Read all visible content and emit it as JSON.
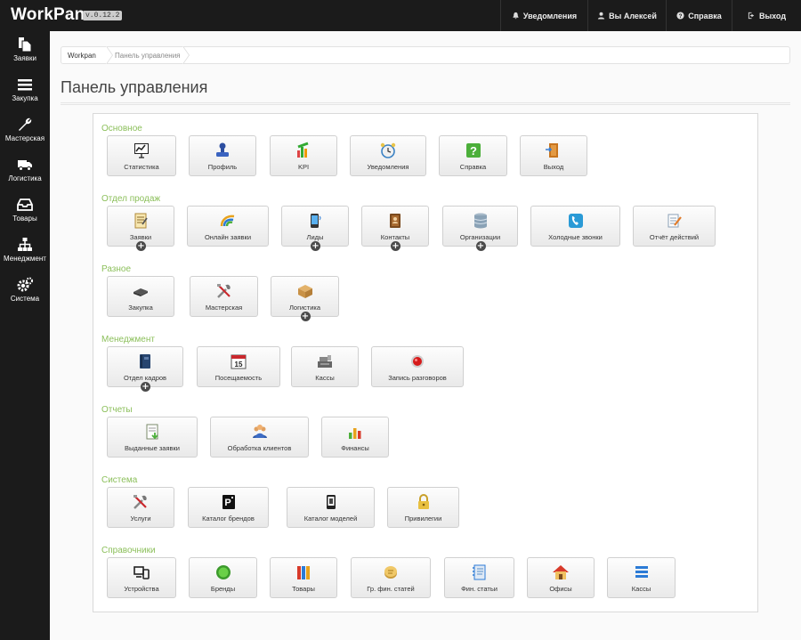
{
  "header": {
    "brand": "WorkPan",
    "version": "v.0.12.2",
    "nav": [
      {
        "label": "Уведомления",
        "icon": "bell-icon"
      },
      {
        "label": "Вы Алексей",
        "icon": "user-icon"
      },
      {
        "label": "Справка",
        "icon": "help-icon"
      },
      {
        "label": "Выход",
        "icon": "logout-icon"
      }
    ]
  },
  "sidebar": {
    "items": [
      {
        "label": "Заявки",
        "icon": "documents-icon"
      },
      {
        "label": "Закупка",
        "icon": "list-icon"
      },
      {
        "label": "Мастерская",
        "icon": "wrench-icon"
      },
      {
        "label": "Логистика",
        "icon": "truck-icon"
      },
      {
        "label": "Товары",
        "icon": "inbox-icon"
      },
      {
        "label": "Менеджмент",
        "icon": "hierarchy-icon"
      },
      {
        "label": "Система",
        "icon": "gears-icon"
      }
    ]
  },
  "breadcrumb": {
    "root": "Workpan",
    "current": "Панель управления"
  },
  "page_title": "Панель управления",
  "sections": [
    {
      "title": "Основное",
      "tiles": [
        {
          "label": "Статистика",
          "icon": "presentation-icon"
        },
        {
          "label": "Профиль",
          "icon": "stamp-icon"
        },
        {
          "label": "KPI",
          "icon": "chart-icon"
        },
        {
          "label": "Уведомления",
          "icon": "alarm-clock-icon"
        },
        {
          "label": "Справка",
          "icon": "question-icon"
        },
        {
          "label": "Выход",
          "icon": "door-icon"
        }
      ]
    },
    {
      "title": "Отдел продаж",
      "tiles": [
        {
          "label": "Заявки",
          "icon": "notepad-icon",
          "plus": "+"
        },
        {
          "label": "Онлайн заявки",
          "icon": "swirl-icon"
        },
        {
          "label": "Лиды",
          "icon": "phone-icon",
          "plus": "+"
        },
        {
          "label": "Контакты",
          "icon": "address-book-icon",
          "plus": "+"
        },
        {
          "label": "Организации",
          "icon": "database-icon",
          "plus": "+"
        },
        {
          "label": "Холодные звонки",
          "icon": "handset-icon"
        },
        {
          "label": "Отчёт действий",
          "icon": "report-icon"
        }
      ]
    },
    {
      "title": "Разное",
      "tiles": [
        {
          "label": "Закупка",
          "icon": "hardware-icon"
        },
        {
          "label": "Мастерская",
          "icon": "tools-icon"
        },
        {
          "label": "Логистика",
          "icon": "box-icon",
          "plus": "+"
        }
      ]
    },
    {
      "title": "Менеджмент",
      "tiles": [
        {
          "label": "Отдел кадров",
          "icon": "book-icon",
          "plus": "+"
        },
        {
          "label": "Посещаемость",
          "icon": "calendar-icon",
          "calendar_day": "15"
        },
        {
          "label": "Кассы",
          "icon": "cash-register-icon"
        },
        {
          "label": "Запись разговоров",
          "icon": "record-icon"
        }
      ]
    },
    {
      "title": "Отчеты",
      "tiles": [
        {
          "label": "Выданные заявки",
          "icon": "doc-download-icon"
        },
        {
          "label": "Обработка клиентов",
          "icon": "people-icon"
        },
        {
          "label": "Финансы",
          "icon": "bars-icon"
        }
      ]
    },
    {
      "title": "Система",
      "tiles": [
        {
          "label": "Услуги",
          "icon": "tools-icon"
        },
        {
          "label": "Каталог брендов",
          "icon": "parking-icon"
        },
        {
          "label": "Каталог моделей",
          "icon": "mobile-icon"
        },
        {
          "label": "Привилегии",
          "icon": "lock-icon"
        }
      ]
    },
    {
      "title": "Справочники",
      "tiles": [
        {
          "label": "Устройства",
          "icon": "devices-icon"
        },
        {
          "label": "Бренды",
          "icon": "green-circle-icon"
        },
        {
          "label": "Товары",
          "icon": "binders-icon"
        },
        {
          "label": "Гр. фин. статей",
          "icon": "coin-icon"
        },
        {
          "label": "Фин. статьи",
          "icon": "notebook-icon"
        },
        {
          "label": "Офисы",
          "icon": "house-icon"
        },
        {
          "label": "Кассы",
          "icon": "list-blue-icon"
        }
      ]
    }
  ]
}
